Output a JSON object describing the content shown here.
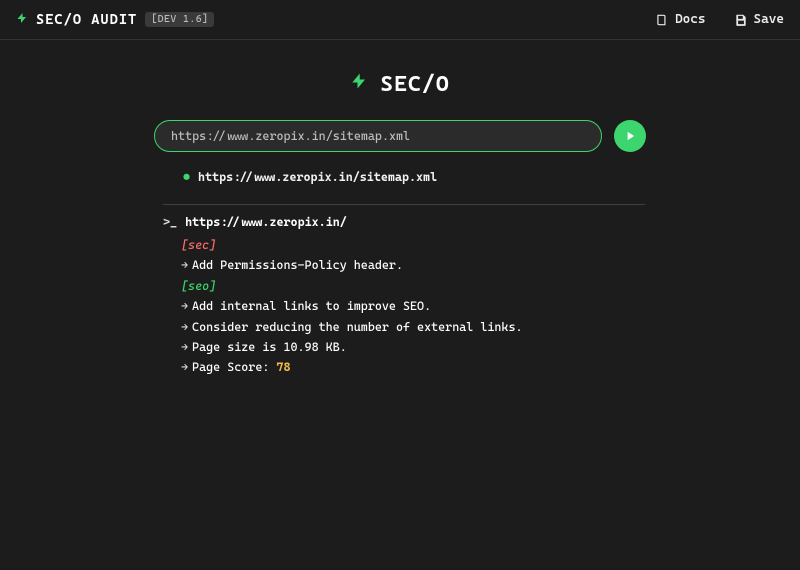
{
  "header": {
    "brand_name": "SEC/O AUDIT",
    "version_badge": "[DEV 1.6]",
    "nav": {
      "docs_label": "Docs",
      "save_label": "Save"
    }
  },
  "logo": {
    "text": "SEC/O"
  },
  "input": {
    "placeholder": "https://www.zeropix.in/sitemap.xml",
    "value": "https://www.zeropix.in/sitemap.xml"
  },
  "consumed": {
    "url": "https://www.zeropix.in/sitemap.xml"
  },
  "result": {
    "prompt_symbol": ">_",
    "page_url": "https://www.zeropix.in/",
    "sec_tag": "[sec]",
    "seo_tag": "[seo]",
    "sec_lines": [
      "Add Permissions-Policy header."
    ],
    "seo_lines": [
      "Add internal links to improve SEO.",
      "Consider reducing the number of external links.",
      "Page size is 10.98 KB."
    ],
    "score_prefix": "Page Score: ",
    "score_value": "78"
  },
  "colors": {
    "accent": "#3dd56d",
    "sec": "#ff6b6b",
    "score": "#f0b84a",
    "bg": "#1c1c1c"
  }
}
